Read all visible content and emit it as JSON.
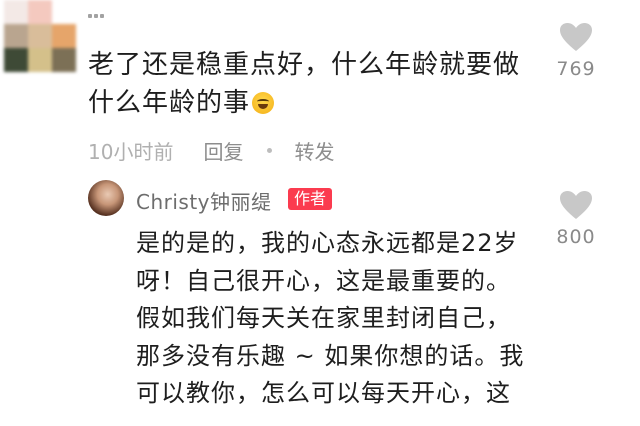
{
  "comment": {
    "lines": [
      "老了还是稳重点好，什么年龄就要做",
      "什么年龄的事"
    ],
    "emoji": "grinning-sweat-face-icon",
    "like_count": "769",
    "time": "10小时前",
    "reply_action": "回复",
    "forward_action": "转发"
  },
  "reply": {
    "author": "Christy钟丽缇",
    "badge": "作者",
    "like_count": "800",
    "lines": [
      "是的是的，我的心态永远都是22岁",
      "呀！自己很开心，这是最重要的。",
      "假如我们每天关在家里封闭自己，",
      "那多没有乐趣 ~ 如果你想的话。我",
      "可以教你，怎么可以每天开心，这"
    ]
  },
  "colors": {
    "badge_red": "#fb3b4f",
    "heart_gray": "#c8c8c8",
    "meta_gray": "#a3a3a3"
  }
}
